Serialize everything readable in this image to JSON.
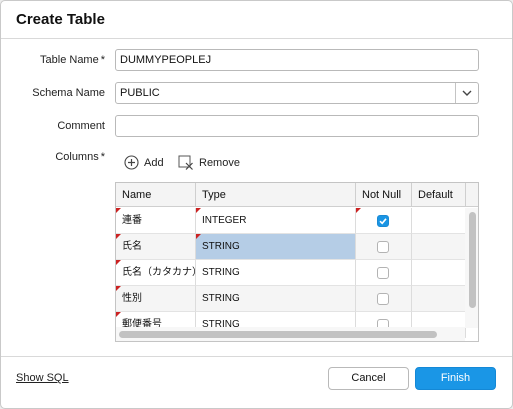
{
  "dialog": {
    "title": "Create Table"
  },
  "form": {
    "table_name": {
      "label": "Table Name",
      "required": "*",
      "value": "DUMMYPEOPLEJ"
    },
    "schema_name": {
      "label": "Schema Name",
      "value": "PUBLIC"
    },
    "comment": {
      "label": "Comment",
      "value": ""
    },
    "columns": {
      "label": "Columns",
      "required": "*"
    }
  },
  "columns_toolbar": {
    "add_label": "Add",
    "remove_label": "Remove"
  },
  "grid": {
    "headers": {
      "name": "Name",
      "type": "Type",
      "not_null": "Not Null",
      "default": "Default"
    },
    "rows": [
      {
        "name": "連番",
        "type": "INTEGER",
        "not_null": true,
        "default": ""
      },
      {
        "name": "氏名",
        "type": "STRING",
        "not_null": false,
        "default": ""
      },
      {
        "name": "氏名（カタカナ）",
        "type": "STRING",
        "not_null": false,
        "default": ""
      },
      {
        "name": "性別",
        "type": "STRING",
        "not_null": false,
        "default": ""
      },
      {
        "name": "郵便番号",
        "type": "STRING",
        "not_null": false,
        "default": ""
      }
    ]
  },
  "footer": {
    "show_sql": "Show SQL",
    "cancel": "Cancel",
    "finish": "Finish"
  },
  "colors": {
    "accent": "#1a96e6",
    "selection": "#b5cde6",
    "required_marker": "#cc2222"
  }
}
